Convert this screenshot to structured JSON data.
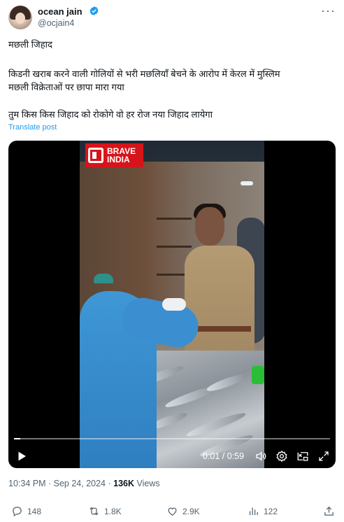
{
  "author": {
    "name": "ocean jain",
    "handle": "@ocjain4",
    "verified": true
  },
  "post": {
    "line1": "मछली जिहाद",
    "line2a": "किडनी खराब करने वाली गोलियों से भरी मछलियाँ बेचने के आरोप में केरल में मुस्लिम",
    "line2b": "मछली विक्रेताओं पर छापा मारा गया",
    "line3": "तुम किस किस जिहाद को रोकोगे वो हर रोज नया जिहाद लायेगा",
    "translate_label": "Translate post"
  },
  "video": {
    "watermark_line1": "BRAVE",
    "watermark_line2": "INDIA",
    "time_readout": "0:01 / 0:59",
    "progress": 0.02
  },
  "meta": {
    "time": "10:34 PM",
    "date": "Sep 24, 2024",
    "views": "136K",
    "views_label": "Views"
  },
  "actions": {
    "replies": "148",
    "reposts": "1.8K",
    "likes": "2.9K",
    "bookmarks": "122"
  },
  "colors": {
    "accent": "#1d9bf0",
    "secondary_text": "#536471",
    "logo_red": "#d7141a"
  },
  "icons": [
    "verified-icon",
    "more-icon",
    "play-icon",
    "volume-icon",
    "settings-icon",
    "pip-icon",
    "fullscreen-icon",
    "reply-icon",
    "repost-icon",
    "like-icon",
    "views-icon",
    "share-icon"
  ]
}
